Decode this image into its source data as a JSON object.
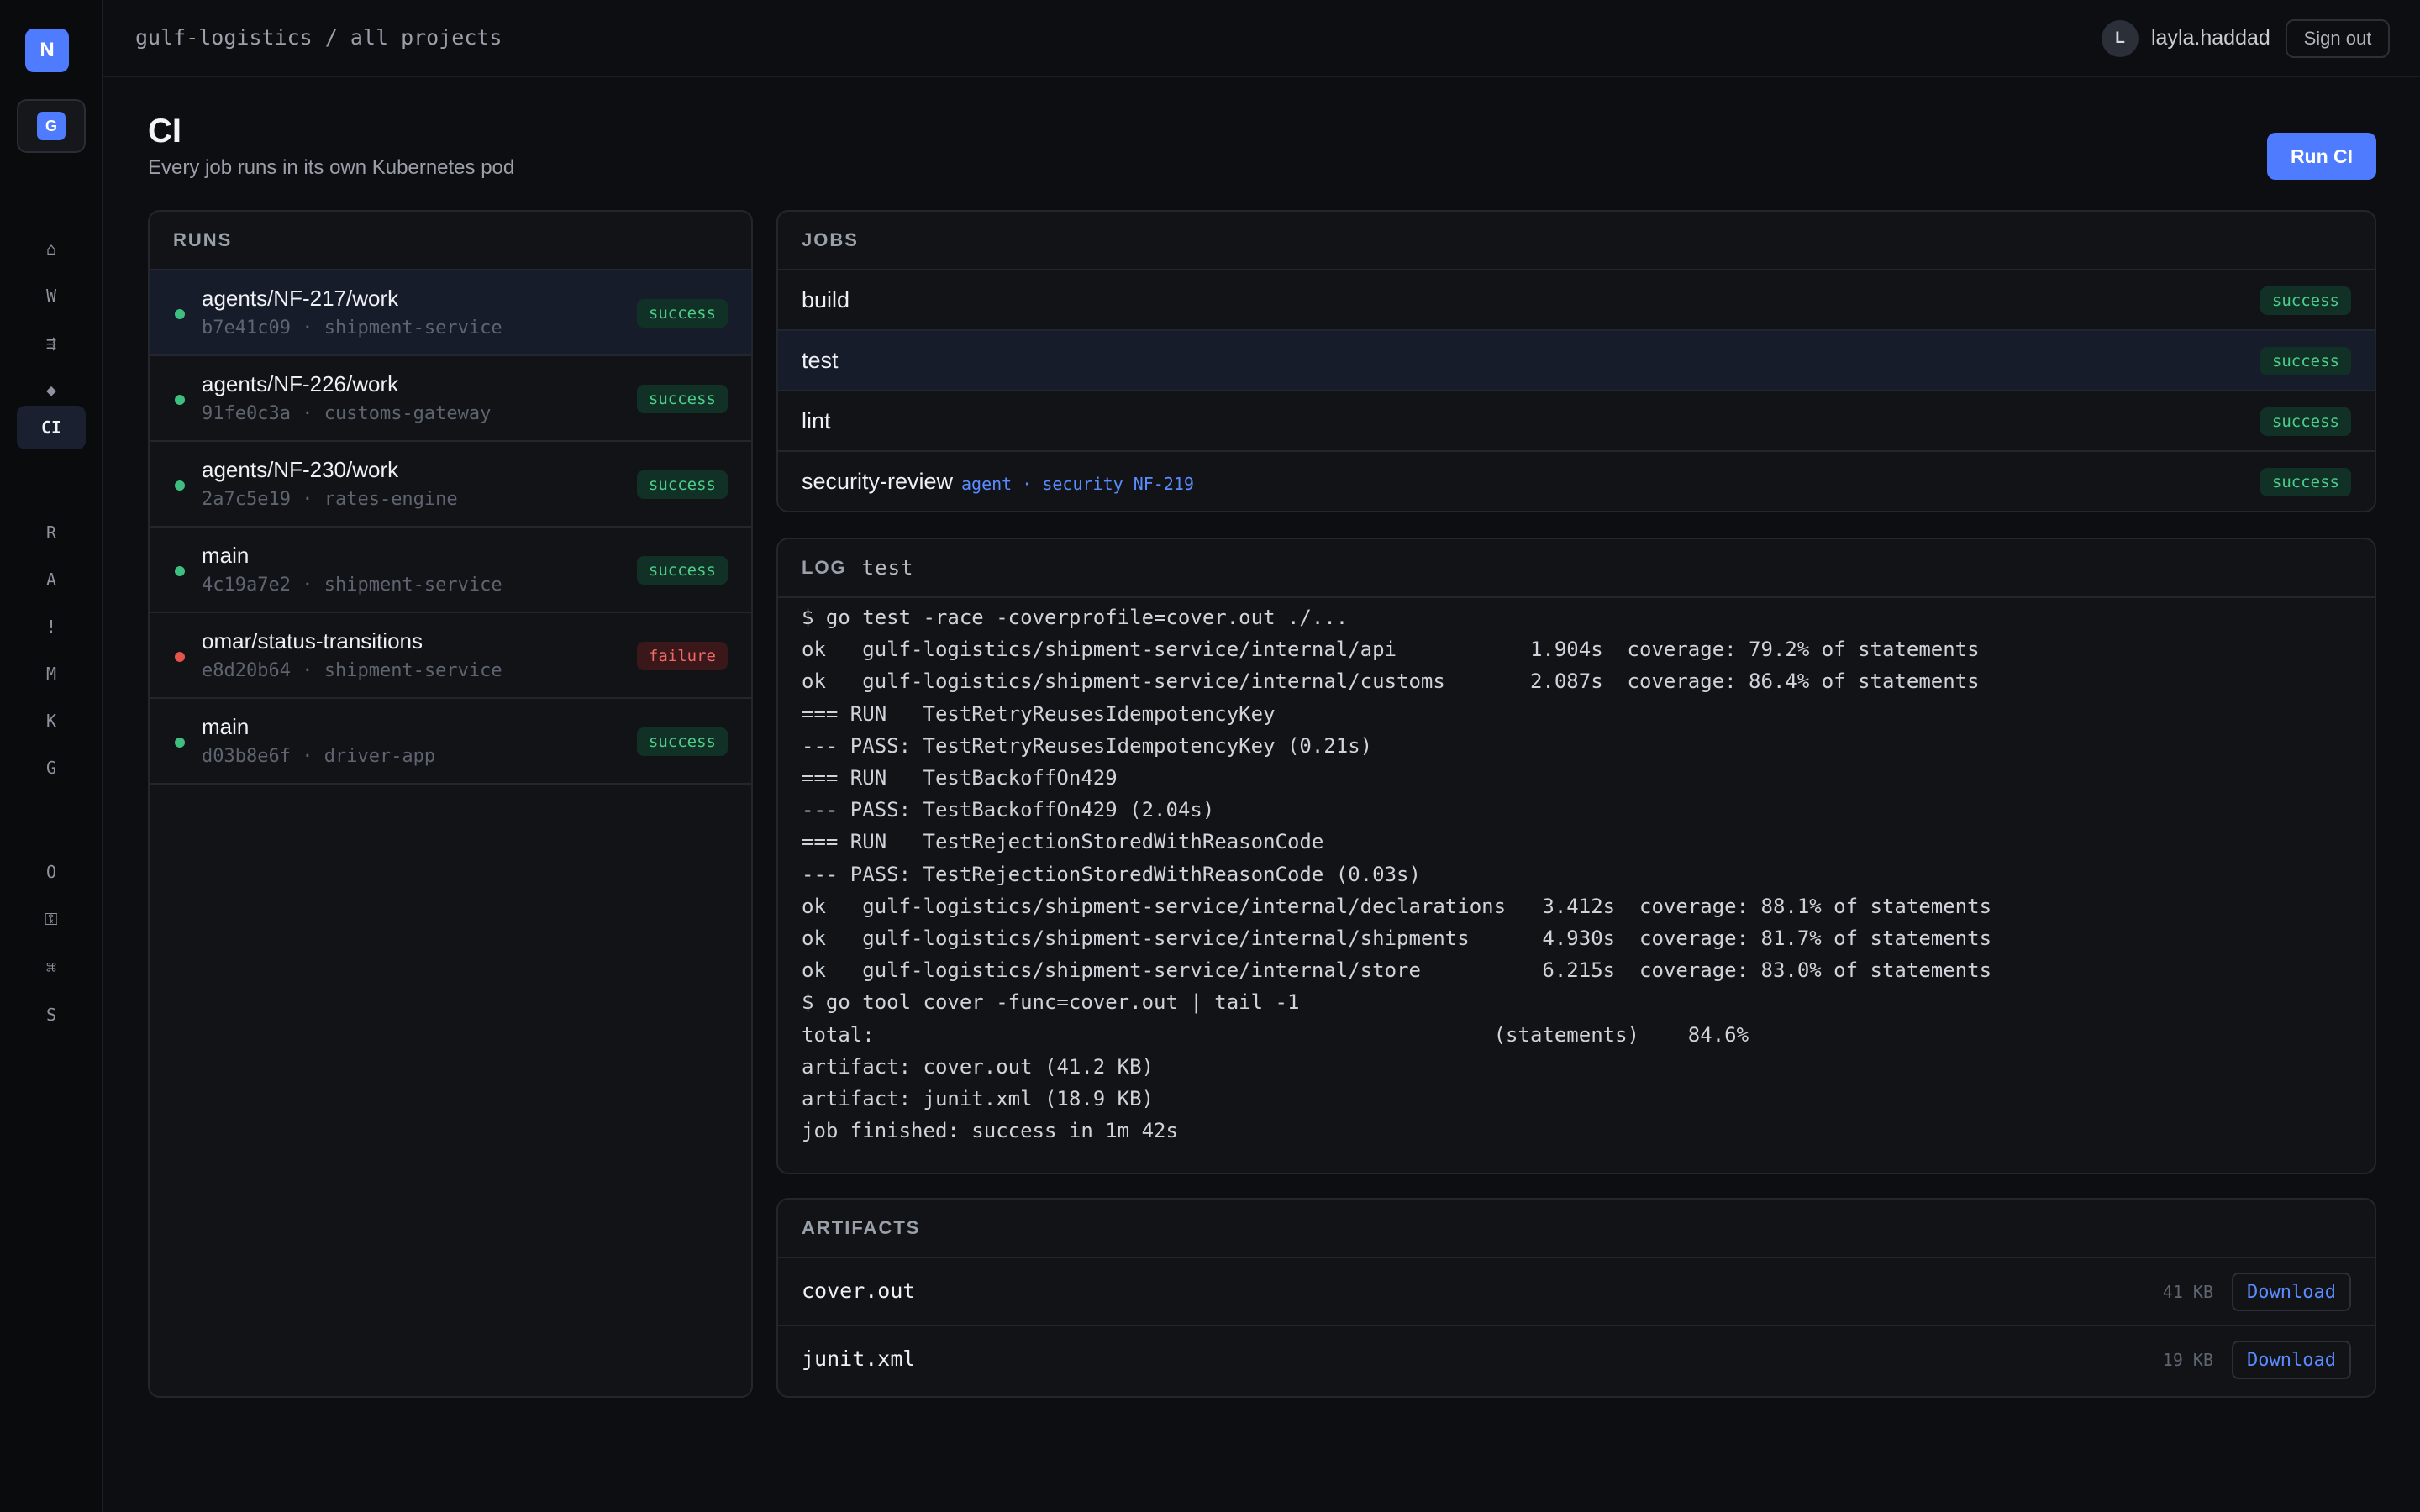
{
  "rail": {
    "logo": "N",
    "org": "G",
    "items": [
      {
        "glyph": "⌂",
        "name": "home"
      },
      {
        "glyph": "W",
        "name": "work"
      },
      {
        "glyph": "⇶",
        "name": "pipelines"
      },
      {
        "glyph": "◆",
        "name": "deploy"
      },
      {
        "glyph": "CI",
        "name": "ci"
      },
      {
        "glyph": "R",
        "name": "r"
      },
      {
        "glyph": "A",
        "name": "a"
      },
      {
        "glyph": "!",
        "name": "alerts"
      },
      {
        "glyph": "M",
        "name": "m"
      },
      {
        "glyph": "K",
        "name": "k"
      },
      {
        "glyph": "G",
        "name": "g"
      },
      {
        "glyph": "O",
        "name": "o"
      },
      {
        "glyph": "⚿",
        "name": "keys"
      },
      {
        "glyph": "⌘",
        "name": "commands"
      },
      {
        "glyph": "S",
        "name": "settings"
      }
    ]
  },
  "topbar": {
    "breadcrumb": "gulf-logistics / all projects",
    "avatar": "L",
    "username": "layla.haddad",
    "signout": "Sign out"
  },
  "header": {
    "title": "CI",
    "subtitle": "Every job runs in its own Kubernetes pod",
    "run_button": "Run CI"
  },
  "runs": {
    "heading": "RUNS",
    "items": [
      {
        "branch": "agents/NF-217/work",
        "sha": "b7e41c09",
        "service": "shipment-service",
        "status": "success"
      },
      {
        "branch": "agents/NF-226/work",
        "sha": "91fe0c3a",
        "service": "customs-gateway",
        "status": "success"
      },
      {
        "branch": "agents/NF-230/work",
        "sha": "2a7c5e19",
        "service": "rates-engine",
        "status": "success"
      },
      {
        "branch": "main",
        "sha": "4c19a7e2",
        "service": "shipment-service",
        "status": "success"
      },
      {
        "branch": "omar/status-transitions",
        "sha": "e8d20b64",
        "service": "shipment-service",
        "status": "failure"
      },
      {
        "branch": "main",
        "sha": "d03b8e6f",
        "service": "driver-app",
        "status": "success"
      }
    ]
  },
  "jobs": {
    "heading": "JOBS",
    "items": [
      {
        "name": "build",
        "status": "success",
        "tags": ""
      },
      {
        "name": "test",
        "status": "success",
        "tags": ""
      },
      {
        "name": "lint",
        "status": "success",
        "tags": ""
      },
      {
        "name": "security-review",
        "status": "success",
        "tags": "agent · security  NF-219"
      }
    ]
  },
  "log": {
    "heading": "LOG",
    "job": "test",
    "lines": [
      "$ go test -race -coverprofile=cover.out ./...",
      "ok   gulf-logistics/shipment-service/internal/api           1.904s  coverage: 79.2% of statements",
      "ok   gulf-logistics/shipment-service/internal/customs       2.087s  coverage: 86.4% of statements",
      "=== RUN   TestRetryReusesIdempotencyKey",
      "--- PASS: TestRetryReusesIdempotencyKey (0.21s)",
      "=== RUN   TestBackoffOn429",
      "--- PASS: TestBackoffOn429 (2.04s)",
      "=== RUN   TestRejectionStoredWithReasonCode",
      "--- PASS: TestRejectionStoredWithReasonCode (0.03s)",
      "ok   gulf-logistics/shipment-service/internal/declarations   3.412s  coverage: 88.1% of statements",
      "ok   gulf-logistics/shipment-service/internal/shipments      4.930s  coverage: 81.7% of statements",
      "ok   gulf-logistics/shipment-service/internal/store          6.215s  coverage: 83.0% of statements",
      "$ go tool cover -func=cover.out | tail -1",
      "total:                                                   (statements)    84.6%",
      "artifact: cover.out (41.2 KB)",
      "artifact: junit.xml (18.9 KB)",
      "job finished: success in 1m 42s"
    ]
  },
  "artifacts": {
    "heading": "ARTIFACTS",
    "items": [
      {
        "name": "cover.out",
        "size": "41 KB",
        "action": "Download"
      },
      {
        "name": "junit.xml",
        "size": "19 KB",
        "action": "Download"
      }
    ]
  },
  "colors": {
    "accent": "#4f7cff",
    "success": "#3fbf7f",
    "failure": "#e5534b",
    "background": "#0d0e11"
  }
}
